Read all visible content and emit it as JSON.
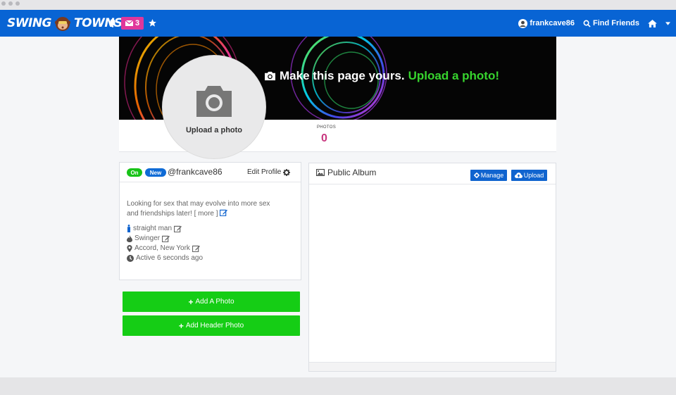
{
  "navbar": {
    "logo_text_left": "SWING",
    "logo_text_right": "TOWNS",
    "mail_count": "3",
    "username": "frankcave86",
    "find_friends": "Find Friends",
    "brand_color": "#0864d4",
    "mail_badge_color": "#e0379b"
  },
  "banner": {
    "cta_text": "Make this page yours.",
    "cta_accent": "Upload a photo!",
    "accent_color": "#37d42e"
  },
  "avatar": {
    "label": "Upload a photo"
  },
  "stats": {
    "photos_label": "PHOTOS",
    "photos_value": "0"
  },
  "profile_card": {
    "status_on": "On",
    "status_new": "New",
    "username": "@frankcave86",
    "edit_label": "Edit Profile",
    "bio_line1": "Looking for sex that may evolve into more sex",
    "bio_line2": "and friendships later! [",
    "bio_more": "more",
    "bio_close": "]",
    "orientation": "straight man",
    "relationship": "Swinger",
    "location": "Accord, New York",
    "activity": "Active 6 seconds ago"
  },
  "actions": {
    "add_photo": "Add A Photo",
    "add_header_photo": "Add Header Photo",
    "button_color": "#15cd15"
  },
  "album": {
    "title": "Public Album",
    "manage_label": "Manage",
    "upload_label": "Upload"
  }
}
